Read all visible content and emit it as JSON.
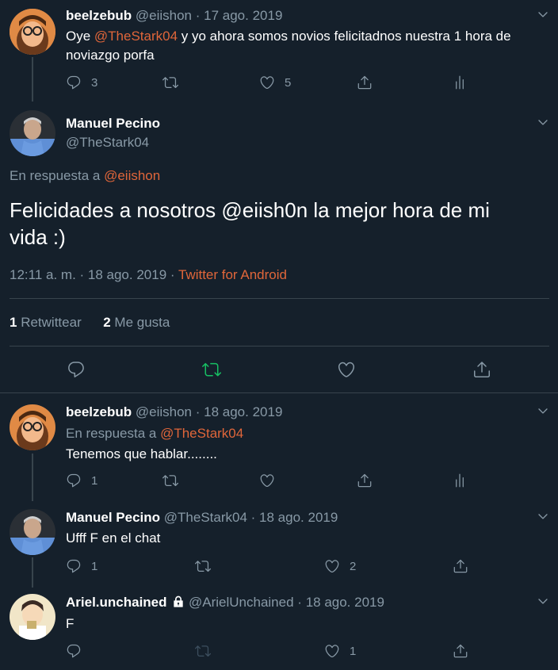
{
  "colors": {
    "background": "#15202b",
    "text": "#ffffff",
    "muted": "#8899a6",
    "link": "#e0663a",
    "retweet_active": "#17bf63",
    "divider": "#38444d"
  },
  "tweet1": {
    "name": "beelzebub",
    "handle": "@eiishon",
    "sep": "·",
    "date": "17 ago. 2019",
    "text_pre": "Oye ",
    "mention": "@TheStark04",
    "text_post": " y yo ahora somos novios felicitadnos nuestra 1 hora de",
    "text_line2": "noviazgo porfa",
    "replies": "3",
    "likes": "5"
  },
  "main": {
    "name": "Manuel Pecino",
    "handle": "@TheStark04",
    "reply_to_label": "En respuesta a ",
    "reply_to_handle": "@eiishon",
    "text_line1": "Felicidades a nosotros @eiish0n la mejor hora de mi",
    "text_line2": "vida :)",
    "time": "12:11 a. m. · 18 ago. 2019",
    "sep": " · ",
    "source": "Twitter for Android",
    "retweets_count": "1",
    "retweets_label": "Retwittear",
    "likes_count": "2",
    "likes_label": "Me gusta"
  },
  "reply1": {
    "name": "beelzebub",
    "handle": "@eiishon",
    "sep": "·",
    "date": "18 ago. 2019",
    "reply_to_label": "En respuesta a ",
    "reply_to_handle": "@TheStark04",
    "text": "Tenemos que hablar........",
    "replies": "1"
  },
  "reply2": {
    "name": "Manuel Pecino",
    "handle": "@TheStark04",
    "sep": "·",
    "date": "18 ago. 2019",
    "text": "Ufff F en el chat",
    "replies": "1",
    "likes": "2"
  },
  "reply3": {
    "name": "Ariel.unchained",
    "handle": "@ArielUnchained",
    "sep": "·",
    "date": "18 ago. 2019",
    "text": "F",
    "likes": "1"
  },
  "icons": [
    "reply-icon",
    "retweet-icon",
    "like-icon",
    "share-icon",
    "analytics-icon",
    "chevron-down-icon",
    "lock-icon"
  ]
}
